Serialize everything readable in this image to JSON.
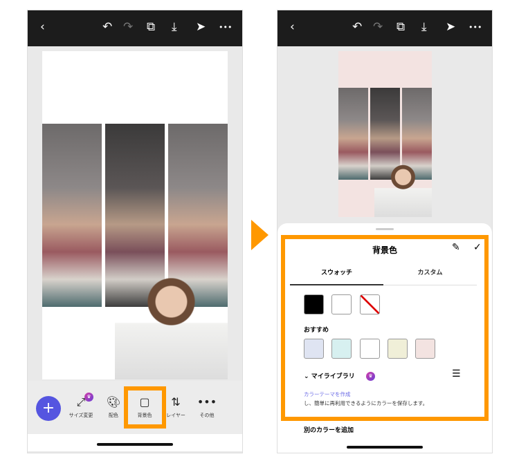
{
  "topbar": {
    "back": "‹",
    "undo": "↶",
    "redo": "↷",
    "pages": "⧉",
    "download": "⤓",
    "share": "➤",
    "more": "•••"
  },
  "toolbar": {
    "add": "+",
    "items": [
      {
        "label": "サイズ変更",
        "icon": "resize-icon"
      },
      {
        "label": "配色",
        "icon": "palette-icon"
      },
      {
        "label": "背景色",
        "icon": "square-icon"
      },
      {
        "label": "レイヤー",
        "icon": "layers-icon"
      },
      {
        "label": "その他",
        "icon": "more-icon"
      }
    ]
  },
  "sheet": {
    "title": "背景色",
    "tabs": [
      "スウォッチ",
      "カスタム"
    ],
    "active_tab": 0,
    "basic_colors": [
      "#000000",
      "#ffffff",
      "none"
    ],
    "recommended_label": "おすすめ",
    "recommended_colors": [
      "#dfe4f2",
      "#d7f0f0",
      "#ffffff",
      "#f0efd8",
      "#f3e3e1"
    ],
    "library_label": "マイライブラリ",
    "create_link": "カラーテーマを作成",
    "help_text": "し、簡単に再利用できるようにカラーを保存します。",
    "add_color": "別のカラーを追加"
  },
  "colors": {
    "accent": "#ff9800",
    "canvas_bg2": "#f3e3e1"
  }
}
